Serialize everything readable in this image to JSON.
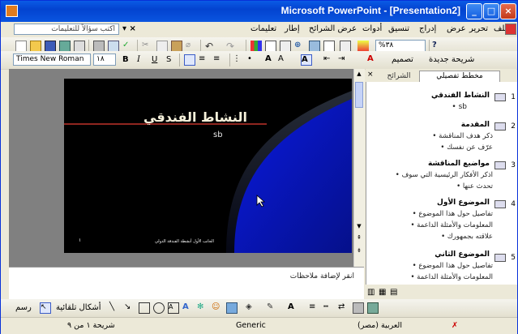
{
  "window": {
    "title": "Microsoft PowerPoint - [Presentation2]"
  },
  "menu": {
    "items": [
      "ملف",
      "تحرير",
      "عرض",
      "إدراج",
      "تنسيق",
      "أدوات",
      "عرض الشرائح",
      "إطار",
      "تعليمات"
    ],
    "help_placeholder": "اكتب سؤالاً للتعليمات"
  },
  "toolbar": {
    "zoom": "%٣٨",
    "font_name": "Times New Roman",
    "font_size": "١٨",
    "new_slide_label": "شريحة جديدة",
    "design_label": "تصميم"
  },
  "slide": {
    "title": "النشاط الفندقي",
    "subtitle": "sb",
    "footer": "الجانب الأول  أنشطة الفندقة الدولي",
    "page_num": "١"
  },
  "pane": {
    "tab_outline": "مخطط تفصيلي",
    "tab_slides": "الشرائح",
    "outline": [
      {
        "num": "1",
        "title": "النشاط الفندقي",
        "bullets": [
          "sb"
        ]
      },
      {
        "num": "2",
        "title": "المقدمة",
        "bullets": [
          "ذكر هدف المناقشة",
          "عرّف عن نفسك"
        ]
      },
      {
        "num": "3",
        "title": "مواضيع المناقشة",
        "bullets": [
          "اذكر الأفكار الرئيسية التي سوف",
          "تحدث عنها"
        ]
      },
      {
        "num": "4",
        "title": "الموضوع الأول",
        "bullets": [
          "تفاصيل حول هذا الموضوع",
          "المعلومات والأمثلة الداعمة",
          "علاقته بجمهورك"
        ]
      },
      {
        "num": "5",
        "title": "الموضوع الثاني",
        "bullets": [
          "تفاصيل حول هذا الموضوع",
          "المعلومات والأمثلة الداعمة"
        ]
      }
    ]
  },
  "notes": {
    "placeholder": "انقر لإضافة ملاحظات"
  },
  "drawing": {
    "draw_label": "رسم",
    "autoshapes_label": "أشكال تلقائية"
  },
  "status": {
    "slide": "شريحة ١ من ٩",
    "design": "Generic",
    "language": "العربية (مصر)"
  }
}
